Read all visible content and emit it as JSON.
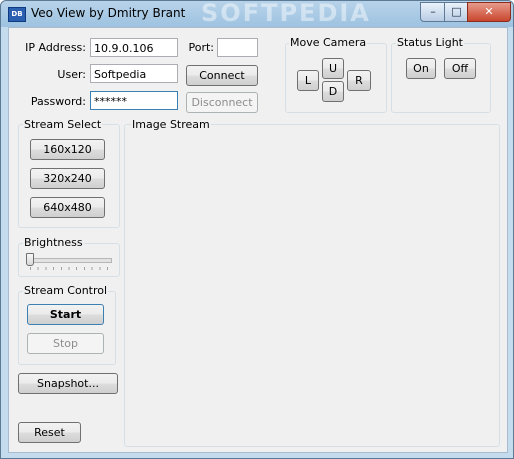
{
  "window": {
    "title": "Veo View by Dmitry Brant",
    "app_icon_text": "DB",
    "watermark": "SOFTPEDIA",
    "min_glyph": "–",
    "max_glyph": "□",
    "close_glyph": "✕"
  },
  "connection": {
    "ip_label": "IP Address:",
    "ip_value": "10.9.0.106",
    "port_label": "Port:",
    "port_value": "",
    "user_label": "User:",
    "user_value": "Softpedia",
    "password_label": "Password:",
    "password_value": "******",
    "connect_label": "Connect",
    "disconnect_label": "Disconnect"
  },
  "move_camera": {
    "title": "Move Camera",
    "up": "U",
    "left": "L",
    "down": "D",
    "right": "R"
  },
  "status_light": {
    "title": "Status Light",
    "on_label": "On",
    "off_label": "Off"
  },
  "stream_select": {
    "title": "Stream Select",
    "options": [
      "160x120",
      "320x240",
      "640x480"
    ]
  },
  "brightness": {
    "title": "Brightness",
    "value_fraction": 0.0
  },
  "stream_control": {
    "title": "Stream Control",
    "start_label": "Start",
    "stop_label": "Stop"
  },
  "snapshot_label": "Snapshot...",
  "reset_label": "Reset",
  "image_stream": {
    "title": "Image Stream"
  },
  "colors": {
    "titlebar": "#9ec2e0",
    "client_bg": "#f0f0f0",
    "focus_border": "#3c7fb1",
    "close_button": "#c9462d"
  }
}
